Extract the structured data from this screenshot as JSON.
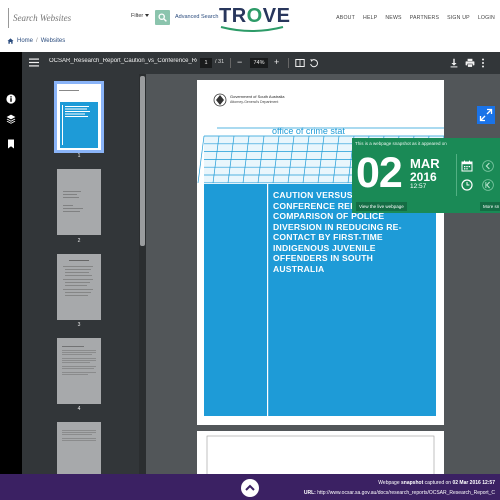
{
  "header": {
    "search_placeholder": "Search Websites",
    "filter_label": "Filter",
    "advanced_label": "Advanced Search",
    "logo_text": "TROVE",
    "nav": [
      "ABOUT",
      "HELP",
      "NEWS",
      "PARTNERS",
      "SIGN UP",
      "LOGIN"
    ]
  },
  "breadcrumb": [
    "Home",
    "Websites"
  ],
  "viewer": {
    "doc_title": "OCSAR_Research_Report_Caution_vs_Conference_Re...",
    "current_page": "1",
    "total_pages": "/ 31",
    "zoom": "74%",
    "thumb_labels": [
      "1",
      "2",
      "3",
      "4"
    ]
  },
  "document": {
    "gov_line1": "Government of South Australia",
    "gov_line2": "Attorney-General's Department",
    "office_name": "office of crime stat",
    "title": "CAUTION VERSUS CONFERENCE REFERRAL: A COMPARISON OF POLICE DIVERSION IN REDUCING RE-CONTACT BY FIRST-TIME INDIGENOUS JUVENILE OFFENDERS IN SOUTH AUSTRALIA"
  },
  "snapshot": {
    "heading": "This is a webpage snapshot as it appeared on",
    "day": "02",
    "month": "MAR",
    "year": "2016",
    "time": "12:57",
    "live_label": "View the live webpage",
    "more_label": "More sn"
  },
  "footer": {
    "prefix": "Webpage",
    "snapshot_word": "snapshot",
    "captured_text": "captured on",
    "captured_date": "02 Mar 2016 12:57",
    "url_label": "URL:",
    "url": "http://www.ocsar.sa.gov.au/docs/research_reports/OCSAR_Research_Report_C"
  },
  "colors": {
    "brand_navy": "#28365c",
    "brand_green": "#2d9b68",
    "snapshot_green": "#1a8a56",
    "footer_purple": "#3b2163",
    "doc_blue": "#1e9bd7",
    "pdf_chrome": "#323639"
  }
}
